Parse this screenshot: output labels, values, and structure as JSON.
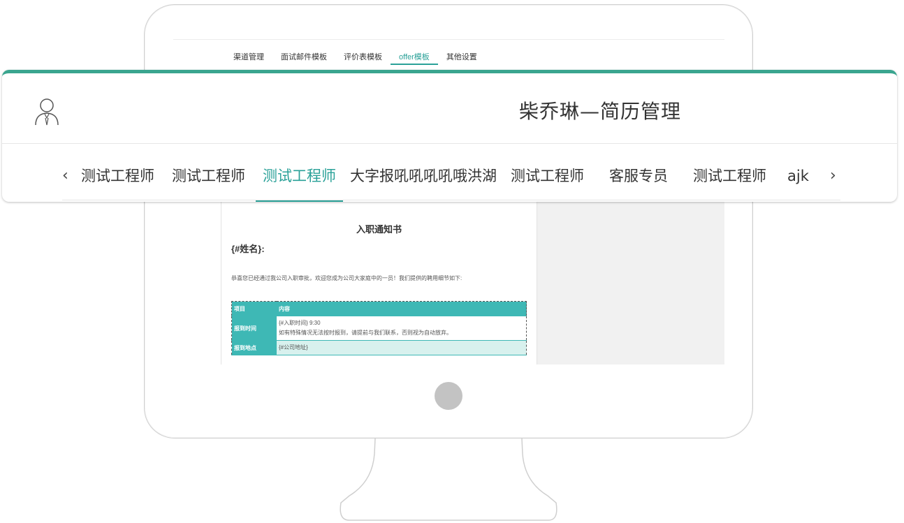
{
  "monitor": {
    "tabs": [
      {
        "label": "渠道管理",
        "active": false
      },
      {
        "label": "面试邮件模板",
        "active": false
      },
      {
        "label": "评价表模板",
        "active": false
      },
      {
        "label": "offer模板",
        "active": true
      },
      {
        "label": "其他设置",
        "active": false
      }
    ],
    "document": {
      "title": "入职通知书",
      "greeting": "{#姓名}:",
      "intro": "恭喜您已经通过我公司入职审批，欢迎您成为公司大家庭中的一员！我们提供的聘用细节如下:",
      "table": {
        "headers": [
          "项目",
          "内容"
        ],
        "rows": [
          {
            "key": "报到时间",
            "value_line1": "{#入职时间} 9:30",
            "value_line2": "如有特殊情况无法按时报到，请提前与我们联系，否则视为自动放弃。"
          },
          {
            "key": "报到地点",
            "value_line1": "{#公司地址}",
            "value_line2": ""
          }
        ]
      }
    }
  },
  "card": {
    "title": "柴乔琳—简历管理",
    "user_icon": "user-icon",
    "accent_color": "#3aa58f",
    "tabs": [
      {
        "label": "测试工程师",
        "active": false
      },
      {
        "label": "测试工程师",
        "active": false
      },
      {
        "label": "测试工程师",
        "active": true
      },
      {
        "label": "大字报吼吼吼吼哦洪湖",
        "active": false
      },
      {
        "label": "测试工程师",
        "active": false
      },
      {
        "label": "客服专员",
        "active": false
      },
      {
        "label": "测试工程师",
        "active": false
      },
      {
        "label": "ajk",
        "active": false
      }
    ],
    "prev_icon": "chevron-left-icon",
    "next_icon": "chevron-right-icon"
  }
}
